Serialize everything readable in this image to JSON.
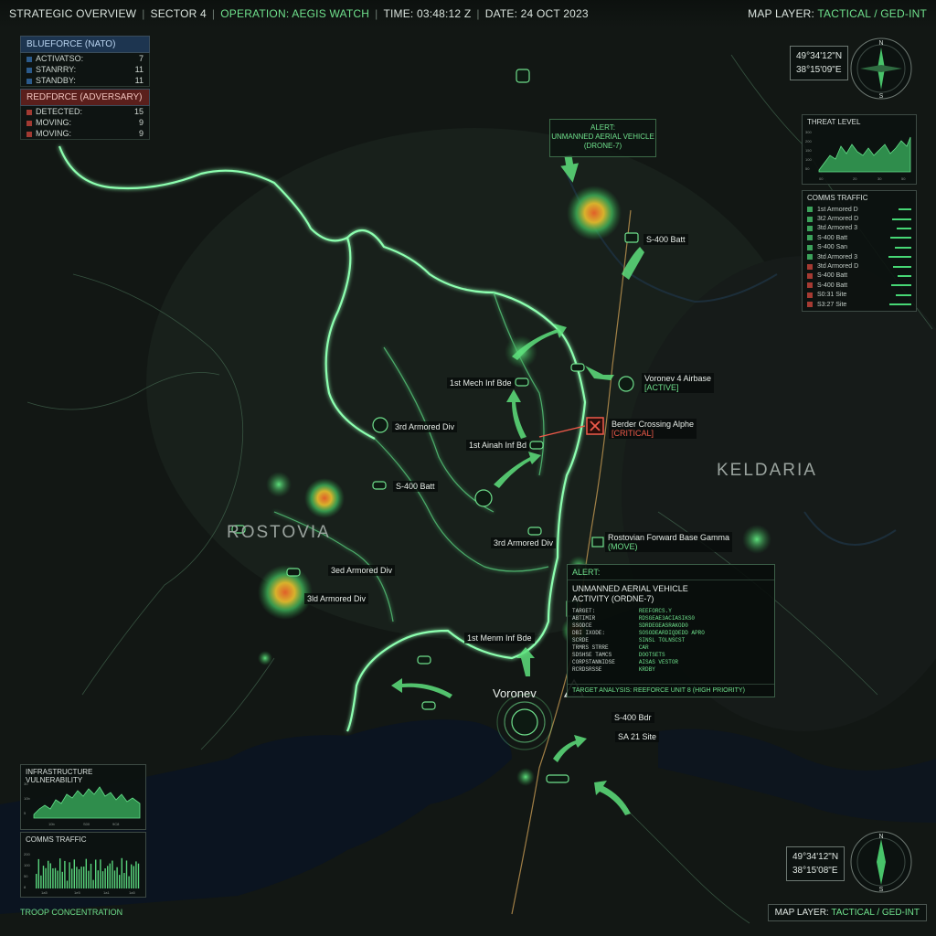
{
  "topbar": {
    "strategic": "STRATEGIC OVERVIEW",
    "sector": "SECTOR 4",
    "operation": "OPERATION: AEGIS WATCH",
    "time": "TIME: 03:48:12 Z",
    "date": "DATE: 24 OCT 2023",
    "map_layer_prefix": "MAP LAYER:",
    "map_layer_value": "TACTICAL / GED-INT"
  },
  "blueforce": {
    "title": "BLUEFORCE (NATO)",
    "rows": [
      {
        "label": "ACTIVATSO:",
        "value": "7"
      },
      {
        "label": "STANRRY:",
        "value": "11"
      },
      {
        "label": "STANDBY:",
        "value": "11"
      }
    ]
  },
  "redforce": {
    "title": "REDFDRCE (ADVERSARY)",
    "rows": [
      {
        "label": "DETECTED:",
        "value": "15"
      },
      {
        "label": "MOVING:",
        "value": "9"
      },
      {
        "label": "MOVING:",
        "value": "9"
      }
    ]
  },
  "coords_top": {
    "lat": "49°34'12\"N",
    "lon": "38°15'09\"E"
  },
  "coords_bottom": {
    "lat": "49°34'12\"N",
    "lon": "38°15'08\"E"
  },
  "compass": {
    "n": "N",
    "s": "S"
  },
  "threat_level": {
    "title": "THREAT LEVEL",
    "yticks": [
      "300",
      "200",
      "150",
      "100",
      "50"
    ],
    "xticks": [
      "00",
      "20",
      "30",
      "50"
    ]
  },
  "comms_right": {
    "title": "COMMS TRAFFIC",
    "rows": [
      {
        "label": "1st Armored D",
        "color": "#3ba25a"
      },
      {
        "label": "3t2 Armored D",
        "color": "#3ba25a"
      },
      {
        "label": "3td Armored 3",
        "color": "#3ba25a"
      },
      {
        "label": "S-400 Batt",
        "color": "#3ba25a"
      },
      {
        "label": "S-400 San",
        "color": "#3ba25a"
      },
      {
        "label": "3td Armored 3",
        "color": "#3ba25a"
      },
      {
        "label": "3td Armored D",
        "color": "#a53a32"
      },
      {
        "label": "S-400 Batt",
        "color": "#a53a32"
      },
      {
        "label": "S-400 Batt",
        "color": "#a53a32"
      },
      {
        "label": "S0:31 Site",
        "color": "#a53a32"
      },
      {
        "label": "S3:27 Site",
        "color": "#a53a32"
      }
    ]
  },
  "infra": {
    "title": "INFRASTRUCTURE VULNERABILITY",
    "yticks": [
      "30",
      "10b",
      "5"
    ],
    "xticks": [
      "10b",
      "S00",
      "9C8"
    ]
  },
  "comms_left": {
    "title": "COMMS TRAFFIC",
    "yticks": [
      "200",
      "100",
      "50",
      "8"
    ],
    "xticks": [
      "1a5",
      "1e5",
      "1a1",
      "1a5"
    ]
  },
  "alert_drone": {
    "title": "ALERT:",
    "line1": "UNMANNED AERIAL VEHICLE",
    "line2": "(DRONE-7)"
  },
  "alert_box": {
    "header": "ALERT:",
    "title1": "UNMANNED AERIAL VEHICLE",
    "title2": "ACTIVITY (ORDNE-7)",
    "rows": [
      {
        "k": "TARGET:",
        "v": "REEFORCS.Y"
      },
      {
        "k": "ABTIMIR",
        "v": "RDSGEAE3ACIASIKS0"
      },
      {
        "k": "SSODCE",
        "v": "SDRDEGEASRAKOD0"
      },
      {
        "k": "DBI IXODE:",
        "v": "SOSODEARDIQDEDD APRO"
      },
      {
        "k": "SCRDE",
        "v": "SINSL TOLNSCST"
      },
      {
        "k": "TRMRS STRRE",
        "v": "CAR"
      },
      {
        "k": "SDSHSE TAMCS",
        "v": "DOOTSETS"
      },
      {
        "k": "CORPSTANNIDSE",
        "v": "AISAS VESTOR"
      },
      {
        "k": "RCRDSRSSE",
        "v": "KRDBY"
      }
    ],
    "footer": "TARGET ANALYSIS: REEFORCE UNIT 8 (HIGH PRIORITY)"
  },
  "map_labels": {
    "s400_top": "S-400 Batt",
    "airbase": "Voronev 4 Airbase",
    "airbase_status": "[ACTIVE]",
    "mech": "1st Mech Inf Bde",
    "armored3_top": "3rd Armored Div",
    "border": "Berder Crossing Alphe",
    "border_status": "[CRITICAL]",
    "inf1": "1st Ainah Inf Bd",
    "s400_mid": "S-400 Batt",
    "armored3_mid": "3rd Armored Div",
    "base": "Rostovian Forward Base Gamma",
    "base_status": "(MOVE)",
    "armored_a": "3ed Armored Div",
    "armored_b": "3ld Armored Div",
    "inf_bottom": "1st Menm Inf Bde",
    "city": "Voronev",
    "s400_bottom": "S-400 Bdr",
    "sa21": "SA 21 Site"
  },
  "regions": {
    "west": "ROSTOVIA",
    "east": "KELDARIA"
  },
  "footer": {
    "left": "TROOP CONCENTRATION"
  },
  "colors": {
    "accent": "#6fe08c",
    "blue": "#1d3550",
    "red": "#5a1f1c",
    "critical": "#ef5a4a",
    "border_glow": "#8dffb0"
  }
}
